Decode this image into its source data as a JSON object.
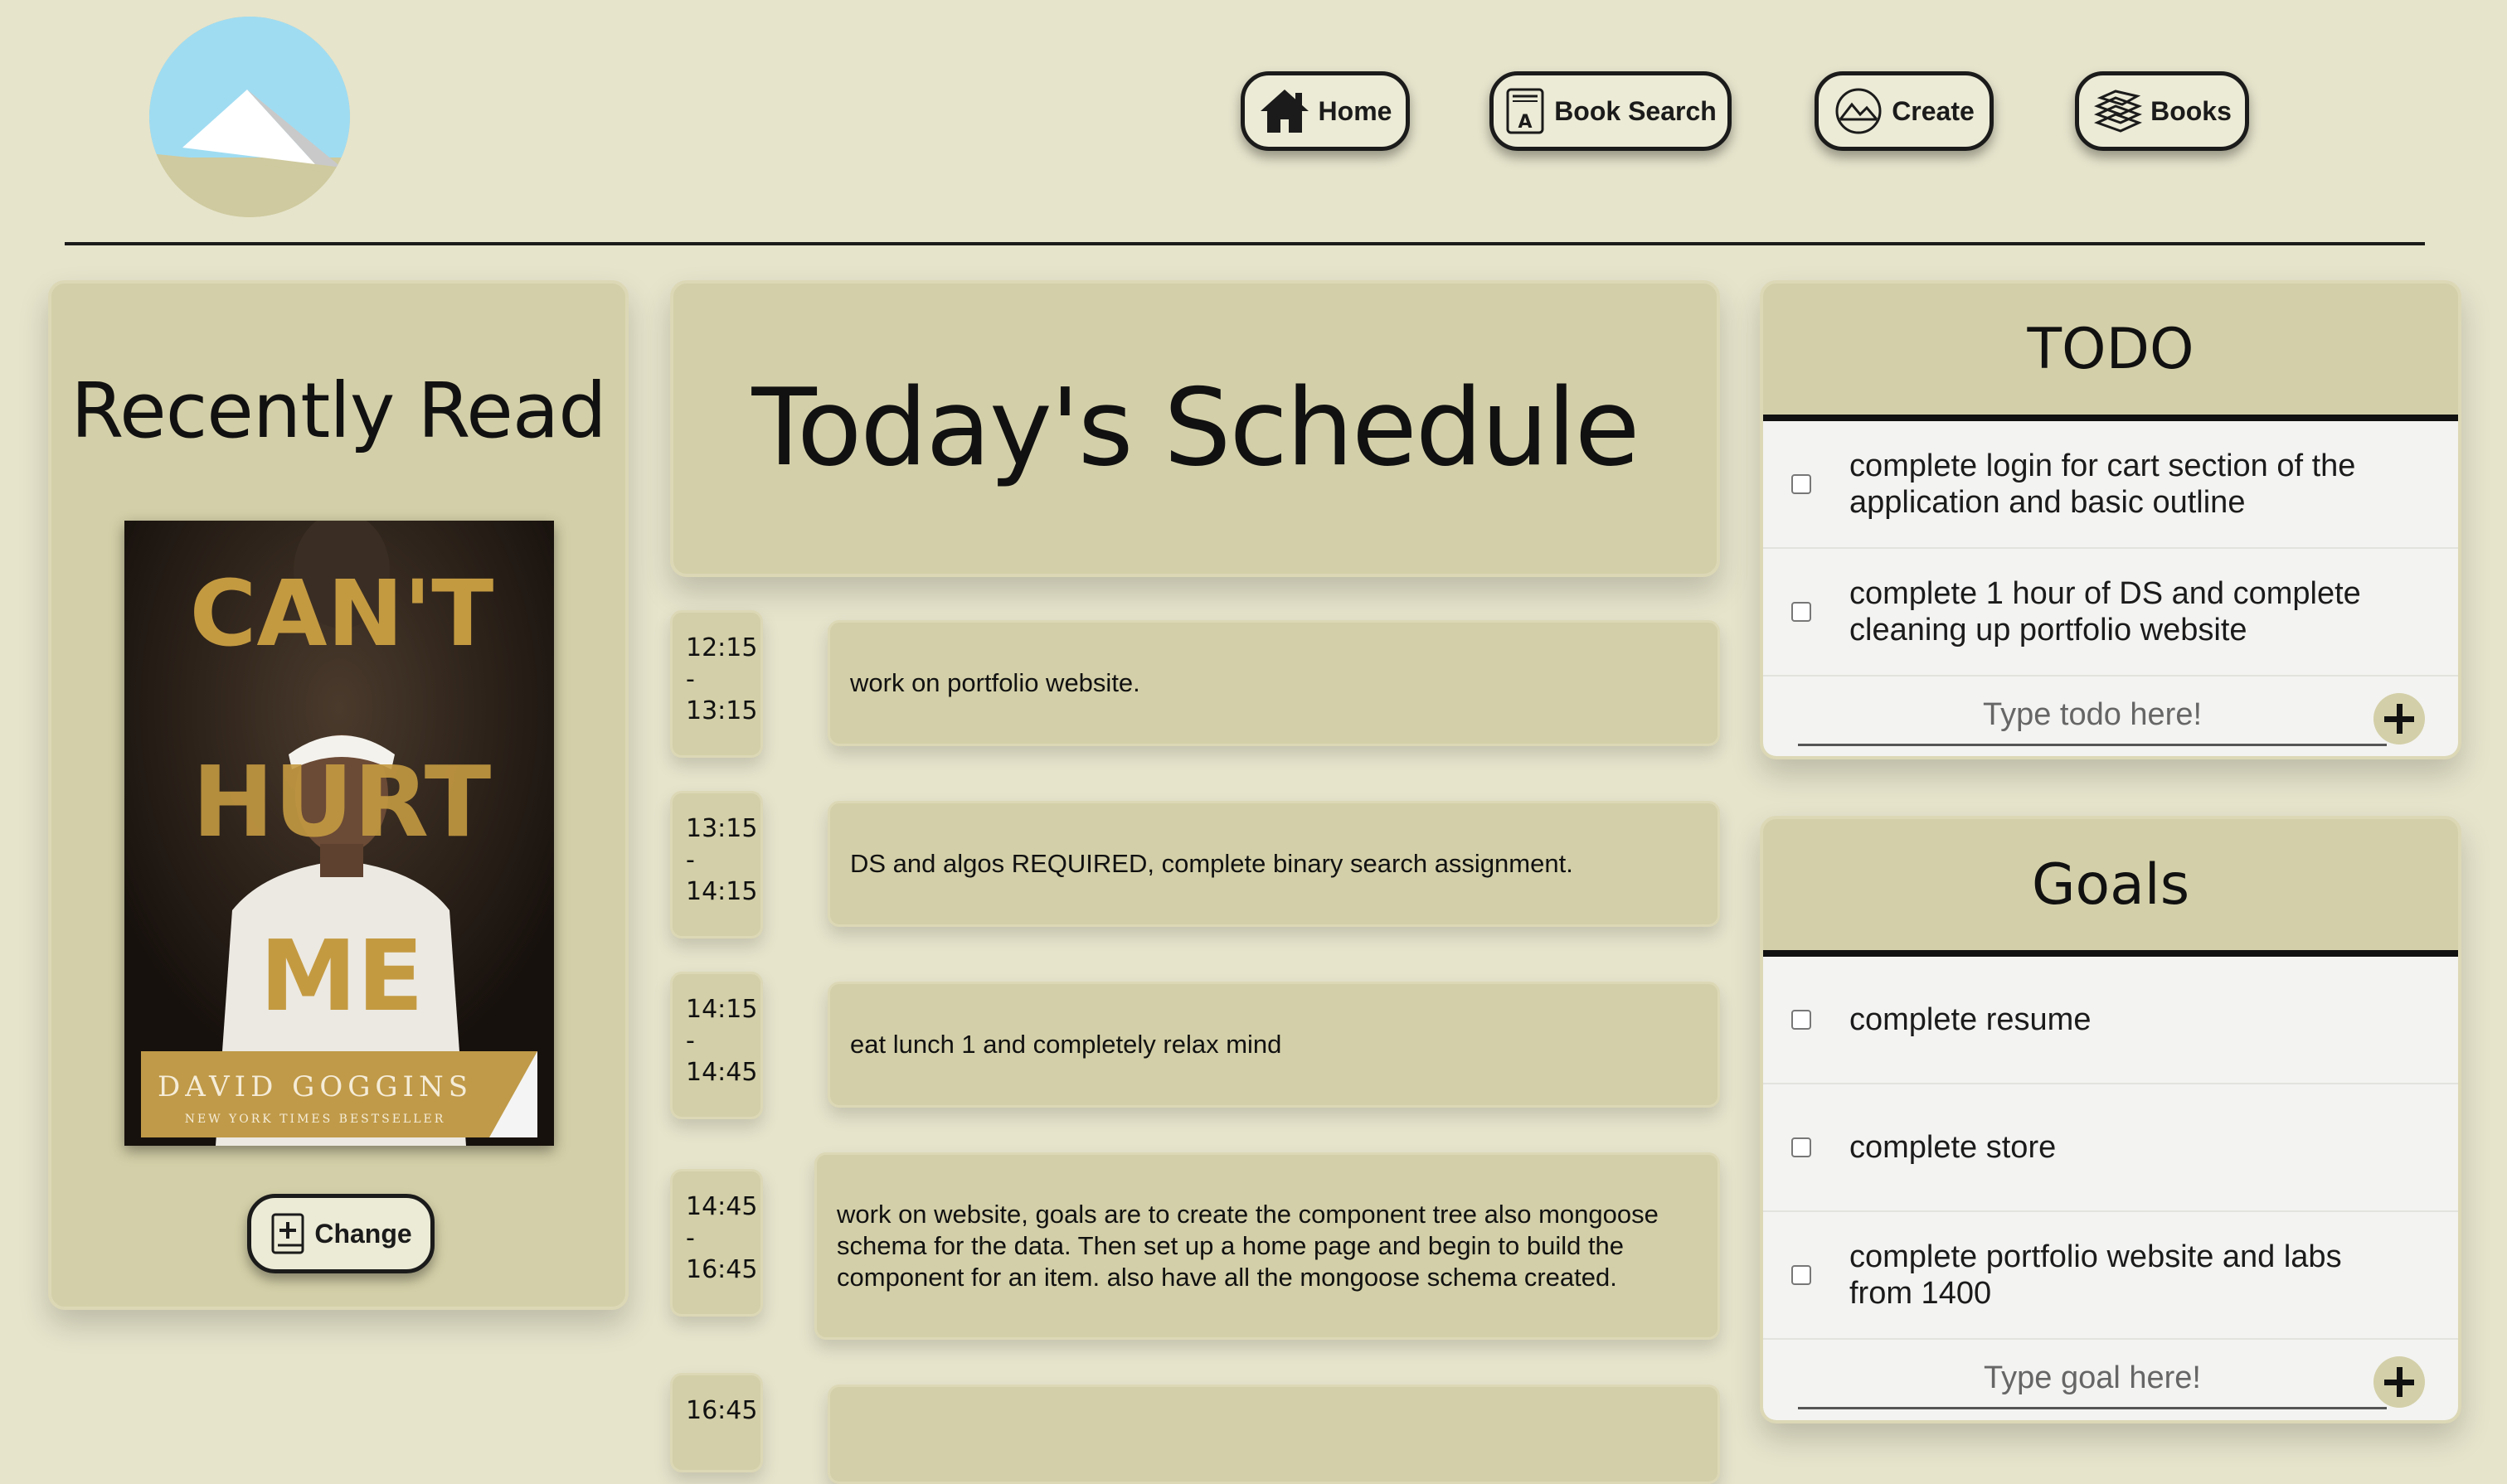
{
  "nav": {
    "home": "Home",
    "book_search": "Book Search",
    "create": "Create",
    "books": "Books"
  },
  "icons": {
    "logo": "mountain-logo-icon",
    "home": "house-icon",
    "book_search": "book-a-icon",
    "create": "mountain-sketch-icon",
    "books": "book-stack-icon",
    "change": "book-plus-icon"
  },
  "colors": {
    "background": "#e6e4cb",
    "card": "#d3cfa8",
    "list_row": "#f3f3f1",
    "text": "#111111"
  },
  "recently_read": {
    "title": "Recently Read",
    "book": {
      "title_line1": "CAN'T",
      "title_line2": "HURT",
      "title_line3": "ME",
      "author": "DAVID GOGGINS",
      "tagline": "NEW YORK TIMES BESTSELLER"
    },
    "change_label": "Change"
  },
  "schedule": {
    "title": "Today's Schedule",
    "items": [
      {
        "start": "12:15",
        "sep": "-",
        "end": "13:15",
        "task": "work on portfolio website."
      },
      {
        "start": "13:15",
        "sep": "-",
        "end": "14:15",
        "task": "DS and algos REQUIRED, complete binary search assignment."
      },
      {
        "start": "14:15",
        "sep": "-",
        "end": "14:45",
        "task": "eat lunch 1 and completely relax mind"
      },
      {
        "start": "14:45",
        "sep": "-",
        "end": "16:45",
        "task": "work on website, goals are to create the component tree also mongoose schema for the data. Then set up a home page and begin to build the component for an item. also have all the mongoose schema created."
      },
      {
        "start": "16:45",
        "sep": "",
        "end": "",
        "task": ""
      }
    ]
  },
  "todo": {
    "title": "TODO",
    "items": [
      {
        "text": "complete login for cart section of the application and basic outline",
        "checked": false
      },
      {
        "text": "complete 1 hour of DS and complete cleaning up portfolio website",
        "checked": false
      }
    ],
    "placeholder": "Type todo here!"
  },
  "goals": {
    "title": "Goals",
    "items": [
      {
        "text": "complete resume",
        "checked": false
      },
      {
        "text": "complete store",
        "checked": false
      },
      {
        "text": "complete portfolio website and labs from 1400",
        "checked": false
      }
    ],
    "placeholder": "Type goal here!"
  }
}
